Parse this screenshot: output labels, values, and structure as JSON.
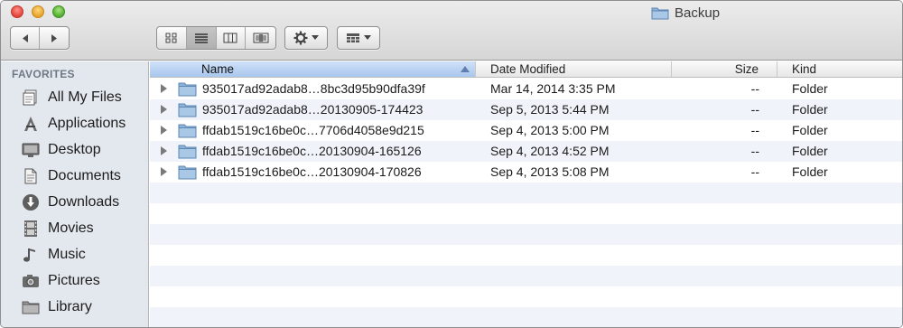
{
  "window": {
    "title": "Backup"
  },
  "toolbar": {
    "nav": {
      "back": "back-arrow",
      "forward": "forward-arrow"
    },
    "views": [
      "icon-view",
      "list-view",
      "column-view",
      "coverflow-view"
    ],
    "active_view": "list-view"
  },
  "sidebar": {
    "heading": "FAVORITES",
    "items": [
      {
        "label": "All My Files",
        "icon": "all-files-icon"
      },
      {
        "label": "Applications",
        "icon": "applications-icon"
      },
      {
        "label": "Desktop",
        "icon": "desktop-icon"
      },
      {
        "label": "Documents",
        "icon": "documents-icon"
      },
      {
        "label": "Downloads",
        "icon": "downloads-icon"
      },
      {
        "label": "Movies",
        "icon": "movies-icon"
      },
      {
        "label": "Music",
        "icon": "music-icon"
      },
      {
        "label": "Pictures",
        "icon": "pictures-icon"
      },
      {
        "label": "Library",
        "icon": "library-icon"
      }
    ]
  },
  "list": {
    "columns": {
      "name": "Name",
      "date": "Date Modified",
      "size": "Size",
      "kind": "Kind"
    },
    "rows": [
      {
        "name": "935017ad92adab8…8bc3d95b90dfa39f",
        "date": "Mar 14, 2014 3:35 PM",
        "size": "--",
        "kind": "Folder"
      },
      {
        "name": "935017ad92adab8…20130905-174423",
        "date": "Sep 5, 2013 5:44 PM",
        "size": "--",
        "kind": "Folder"
      },
      {
        "name": "ffdab1519c16be0c…7706d4058e9d215",
        "date": "Sep 4, 2013 5:00 PM",
        "size": "--",
        "kind": "Folder"
      },
      {
        "name": "ffdab1519c16be0c…20130904-165126",
        "date": "Sep 4, 2013 4:52 PM",
        "size": "--",
        "kind": "Folder"
      },
      {
        "name": "ffdab1519c16be0c…20130904-170826",
        "date": "Sep 4, 2013 5:08 PM",
        "size": "--",
        "kind": "Folder"
      }
    ]
  },
  "colors": {
    "folder": "#8db3d9",
    "header_selected": "#b9d2f2",
    "stripe": "#f0f4fa",
    "sidebar": "#e3e7ee"
  }
}
